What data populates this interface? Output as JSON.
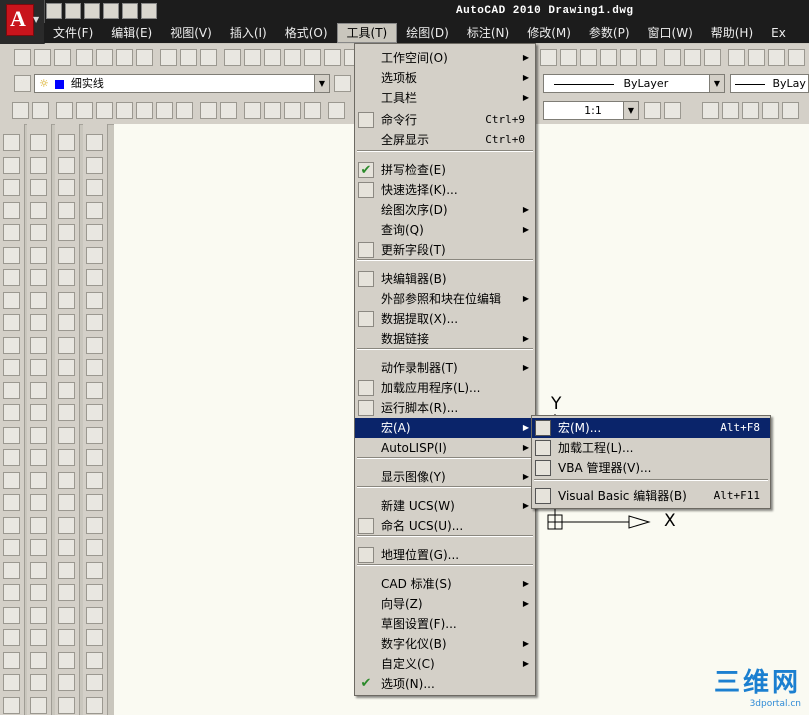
{
  "window": {
    "title": "AutoCAD 2010  Drawing1.dwg",
    "app_logo_letter": "A"
  },
  "menubar": [
    "文件(F)",
    "编辑(E)",
    "视图(V)",
    "插入(I)",
    "格式(O)",
    "工具(T)",
    "绘图(D)",
    "标注(N)",
    "修改(M)",
    "参数(P)",
    "窗口(W)",
    "帮助(H)",
    "Ex"
  ],
  "layer": {
    "name": "细实线"
  },
  "props": {
    "color": "ByLayer",
    "linetype": "ByLayer",
    "lineweight": "ByLay"
  },
  "scale": "1:1",
  "menu": [
    {
      "label": "工作空间(O)",
      "submenu": true
    },
    {
      "label": "选项板",
      "submenu": true
    },
    {
      "label": "工具栏",
      "submenu": true
    },
    {
      "label": "命令行",
      "shortcut": "Ctrl+9",
      "icon": "command-line-icon"
    },
    {
      "label": "全屏显示",
      "shortcut": "Ctrl+0"
    },
    {
      "label": "拼写检查(E)",
      "icon": "spell-check-icon"
    },
    {
      "label": "快速选择(K)...",
      "icon": "quick-select-icon"
    },
    {
      "label": "绘图次序(D)",
      "submenu": true
    },
    {
      "label": "查询(Q)",
      "submenu": true
    },
    {
      "label": "更新字段(T)",
      "icon": "update-field-icon"
    },
    {
      "label": "块编辑器(B)",
      "icon": "block-editor-icon"
    },
    {
      "label": "外部参照和块在位编辑",
      "submenu": true
    },
    {
      "label": "数据提取(X)...",
      "icon": "data-extraction-icon"
    },
    {
      "label": "数据链接",
      "submenu": true
    },
    {
      "label": "动作录制器(T)",
      "submenu": true
    },
    {
      "label": "加载应用程序(L)...",
      "icon": "load-application-icon"
    },
    {
      "label": "运行脚本(R)...",
      "icon": "run-script-icon"
    },
    {
      "label": "宏(A)",
      "submenu": true
    },
    {
      "label": "AutoLISP(I)",
      "submenu": true
    },
    {
      "label": "显示图像(Y)",
      "submenu": true
    },
    {
      "label": "新建 UCS(W)",
      "submenu": true
    },
    {
      "label": "命名 UCS(U)...",
      "icon": "named-ucs-icon"
    },
    {
      "label": "地理位置(G)...",
      "icon": "geographic-location-icon"
    },
    {
      "label": "CAD 标准(S)",
      "submenu": true
    },
    {
      "label": "向导(Z)",
      "submenu": true
    },
    {
      "label": "草图设置(F)..."
    },
    {
      "label": "数字化仪(B)",
      "submenu": true
    },
    {
      "label": "自定义(C)",
      "submenu": true
    },
    {
      "label": "选项(N)...",
      "icon": "options-check-icon"
    }
  ],
  "submenu": [
    {
      "label": "宏(M)...",
      "shortcut": "Alt+F8",
      "icon": "vba-macro-icon"
    },
    {
      "label": "加载工程(L)...",
      "icon": "vba-load-icon"
    },
    {
      "label": "VBA 管理器(V)...",
      "icon": "vba-manager-icon"
    },
    {
      "label": "Visual Basic 编辑器(B)",
      "shortcut": "Alt+F11",
      "icon": "vb-editor-icon"
    }
  ],
  "ucs": {
    "x_label": "X",
    "y_label": "Y"
  },
  "watermark": {
    "big": "三维网",
    "small": "3dportal.cn"
  },
  "colors": {
    "highlight": "#0a246a",
    "canvas": "#fafaf2",
    "titlebar": "#1c1c1c",
    "layer_swatch": "#0000ff"
  }
}
